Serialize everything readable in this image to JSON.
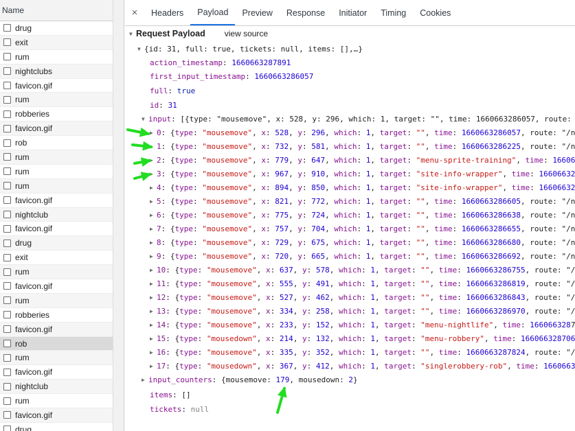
{
  "left_panel": {
    "header": "Name",
    "requests": [
      "drug",
      "exit",
      "rum",
      "nightclubs",
      "favicon.gif",
      "rum",
      "robberies",
      "favicon.gif",
      "rob",
      "rum",
      "rum",
      "rum",
      "favicon.gif",
      "nightclub",
      "favicon.gif",
      "drug",
      "exit",
      "rum",
      "favicon.gif",
      "rum",
      "robberies",
      "favicon.gif",
      "rob",
      "rum",
      "favicon.gif",
      "nightclub",
      "rum",
      "favicon.gif",
      "drug"
    ],
    "selected_index": 22
  },
  "tabs": {
    "close_icon": "×",
    "items": [
      "Headers",
      "Payload",
      "Preview",
      "Response",
      "Initiator",
      "Timing",
      "Cookies"
    ],
    "active": "Payload"
  },
  "payload": {
    "section_title": "Request Payload",
    "view_source": "view source",
    "root_summary": "{id: 31, full: true, tickets: null, items: [],…}",
    "action_timestamp": {
      "key": "action_timestamp",
      "value": "1660663287891"
    },
    "first_input_timestamp": {
      "key": "first_input_timestamp",
      "value": "1660663286057"
    },
    "full": {
      "key": "full",
      "value": "true"
    },
    "id": {
      "key": "id",
      "value": "31"
    },
    "input": {
      "key": "input",
      "summary": "[{type: \"mousemove\", x: 528, y: 296, which: 1, target: \"\", time: 1660663286057, route: "
    },
    "input_items": [
      {
        "idx": "0",
        "type": "\"mousemove\"",
        "x": "528",
        "y": "296",
        "which": "1",
        "target": "\"\"",
        "time": "1660663286057",
        "tail": ", route: \"/n"
      },
      {
        "idx": "1",
        "type": "\"mousemove\"",
        "x": "732",
        "y": "581",
        "which": "1",
        "target": "\"\"",
        "time": "1660663286225",
        "tail": ", route: \"/n"
      },
      {
        "idx": "2",
        "type": "\"mousemove\"",
        "x": "779",
        "y": "647",
        "which": "1",
        "target": "\"menu-sprite-training\"",
        "time": "16606",
        "tail": ""
      },
      {
        "idx": "3",
        "type": "\"mousemove\"",
        "x": "967",
        "y": "910",
        "which": "1",
        "target": "\"site-info-wrapper\"",
        "time": "16606632",
        "tail": ""
      },
      {
        "idx": "4",
        "type": "\"mousemove\"",
        "x": "894",
        "y": "850",
        "which": "1",
        "target": "\"site-info-wrapper\"",
        "time": "16606632",
        "tail": ""
      },
      {
        "idx": "5",
        "type": "\"mousemove\"",
        "x": "821",
        "y": "772",
        "which": "1",
        "target": "\"\"",
        "time": "1660663286605",
        "tail": ", route: \"/n"
      },
      {
        "idx": "6",
        "type": "\"mousemove\"",
        "x": "775",
        "y": "724",
        "which": "1",
        "target": "\"\"",
        "time": "1660663286638",
        "tail": ", route: \"/n"
      },
      {
        "idx": "7",
        "type": "\"mousemove\"",
        "x": "757",
        "y": "704",
        "which": "1",
        "target": "\"\"",
        "time": "1660663286655",
        "tail": ", route: \"/n"
      },
      {
        "idx": "8",
        "type": "\"mousemove\"",
        "x": "729",
        "y": "675",
        "which": "1",
        "target": "\"\"",
        "time": "1660663286680",
        "tail": ", route: \"/n"
      },
      {
        "idx": "9",
        "type": "\"mousemove\"",
        "x": "720",
        "y": "665",
        "which": "1",
        "target": "\"\"",
        "time": "1660663286692",
        "tail": ", route: \"/n"
      },
      {
        "idx": "10",
        "type": "\"mousemove\"",
        "x": "637",
        "y": "578",
        "which": "1",
        "target": "\"\"",
        "time": "1660663286755",
        "tail": ", route: \"/"
      },
      {
        "idx": "11",
        "type": "\"mousemove\"",
        "x": "555",
        "y": "491",
        "which": "1",
        "target": "\"\"",
        "time": "1660663286819",
        "tail": ", route: \"/"
      },
      {
        "idx": "12",
        "type": "\"mousemove\"",
        "x": "527",
        "y": "462",
        "which": "1",
        "target": "\"\"",
        "time": "1660663286843",
        "tail": ", route: \"/"
      },
      {
        "idx": "13",
        "type": "\"mousemove\"",
        "x": "334",
        "y": "258",
        "which": "1",
        "target": "\"\"",
        "time": "1660663286970",
        "tail": ", route: \"/"
      },
      {
        "idx": "14",
        "type": "\"mousemove\"",
        "x": "233",
        "y": "152",
        "which": "1",
        "target": "\"menu-nightlife\"",
        "time": "166066328",
        "tail": "7"
      },
      {
        "idx": "15",
        "type": "\"mousedown\"",
        "x": "214",
        "y": "132",
        "which": "1",
        "target": "\"menu-robbery\"",
        "time": "166066328706",
        "tail": ""
      },
      {
        "idx": "16",
        "type": "\"mousemove\"",
        "x": "335",
        "y": "352",
        "which": "1",
        "target": "\"\"",
        "time": "1660663287824",
        "tail": ", route: \"/"
      },
      {
        "idx": "17",
        "type": "\"mousedown\"",
        "x": "367",
        "y": "412",
        "which": "1",
        "target": "\"singlerobbery-rob\"",
        "time": "1660663",
        "tail": ""
      }
    ],
    "input_counters": {
      "key": "input_counters",
      "summary_open": "{mousemove: ",
      "mousemove": "179",
      "mid": ", mousedown: ",
      "mousedown": "2",
      "summary_close": "}"
    },
    "items": {
      "key": "items",
      "value": "[]"
    },
    "tickets": {
      "key": "tickets",
      "value": "null"
    }
  },
  "annotations": {
    "arrow_color": "#22dd22",
    "arrow_icon": "green-arrow-icon"
  },
  "colors": {
    "key": "#881391",
    "number": "#1c00cf",
    "string": "#c41a16",
    "active_tab": "#1a73e8"
  }
}
